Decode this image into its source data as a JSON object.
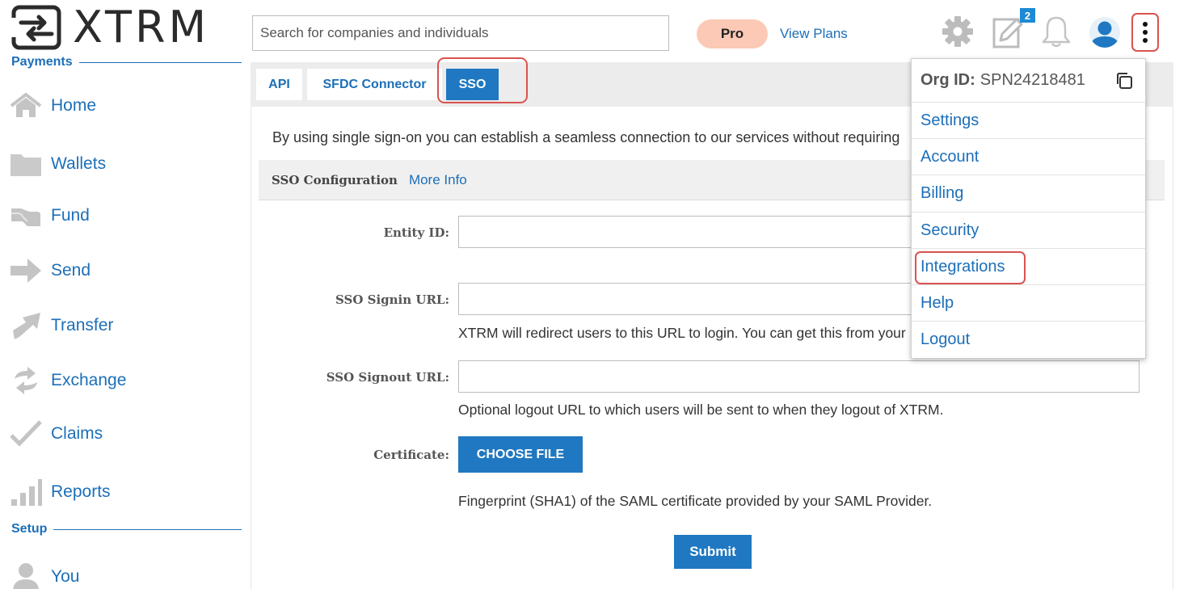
{
  "brand": {
    "name": "XTRM"
  },
  "sidebar": {
    "sections": [
      {
        "label": "Payments"
      },
      {
        "label": "Setup"
      }
    ],
    "items": [
      {
        "label": "Home",
        "icon": "home-icon"
      },
      {
        "label": "Wallets",
        "icon": "folder-icon"
      },
      {
        "label": "Fund",
        "icon": "hand-icon"
      },
      {
        "label": "Send",
        "icon": "arrow-right-icon"
      },
      {
        "label": "Transfer",
        "icon": "arrow-up-right-icon"
      },
      {
        "label": "Exchange",
        "icon": "exchange-icon"
      },
      {
        "label": "Claims",
        "icon": "check-icon"
      },
      {
        "label": "Reports",
        "icon": "bar-chart-icon"
      },
      {
        "label": "You",
        "icon": "user-icon"
      }
    ]
  },
  "header": {
    "search_placeholder": "Search for companies and individuals",
    "plan_badge": "Pro",
    "view_plans": "View Plans",
    "notes_count": "2"
  },
  "tabs": [
    {
      "label": "API",
      "active": false
    },
    {
      "label": "SFDC Connector",
      "active": false
    },
    {
      "label": "SSO",
      "active": true
    }
  ],
  "main": {
    "intro": "By using single sign-on you can establish a seamless connection to our services without requiring",
    "config_title": "SSO Configuration",
    "more_info": "More Info",
    "fields": {
      "entity_id": {
        "label": "Entity ID:",
        "value": ""
      },
      "signin_url": {
        "label": "SSO Signin URL:",
        "value": "",
        "help": "XTRM will redirect users to this URL to login. You can get this from your"
      },
      "signout_url": {
        "label": "SSO Signout URL:",
        "value": "",
        "help": "Optional logout URL to which users will be sent to when they logout of XTRM."
      },
      "certificate": {
        "label": "Certificate:",
        "button": "CHOOSE FILE",
        "help": "Fingerprint (SHA1) of the SAML certificate provided by your SAML Provider."
      }
    },
    "submit": "Submit"
  },
  "dropdown": {
    "org_label": "Org ID:",
    "org_id": "SPN24218481",
    "items": [
      "Settings",
      "Account",
      "Billing",
      "Security",
      "Integrations",
      "Help",
      "Logout"
    ]
  },
  "colors": {
    "accent": "#1f78c1",
    "link": "#1c6fb8",
    "highlight": "#d9534f",
    "pro_badge": "#fbc9b5"
  }
}
